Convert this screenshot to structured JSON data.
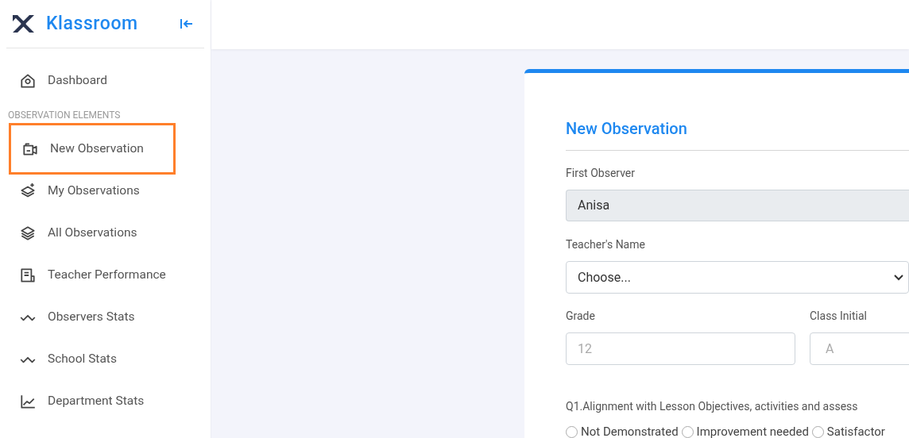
{
  "brand": {
    "name": "Klassroom"
  },
  "sidebar": {
    "items": [
      {
        "kind": "link",
        "label": "Dashboard",
        "highlighted": false
      },
      {
        "kind": "heading",
        "label": "OBSERVATION ELEMENTS"
      },
      {
        "kind": "link",
        "label": "New Observation",
        "highlighted": true
      },
      {
        "kind": "link",
        "label": "My Observations",
        "highlighted": false
      },
      {
        "kind": "link",
        "label": "All Observations",
        "highlighted": false
      },
      {
        "kind": "link",
        "label": "Teacher Performance",
        "highlighted": false
      },
      {
        "kind": "link",
        "label": "Observers Stats",
        "highlighted": false
      },
      {
        "kind": "link",
        "label": "School Stats",
        "highlighted": false
      },
      {
        "kind": "link",
        "label": "Department Stats",
        "highlighted": false
      }
    ]
  },
  "form": {
    "title": "New Observation",
    "first_observer": {
      "label": "First Observer",
      "value": "Anisa"
    },
    "teacher_name": {
      "label": "Teacher's Name",
      "value": "Choose..."
    },
    "grade": {
      "label": "Grade",
      "placeholder": "12"
    },
    "class_initial": {
      "label": "Class Initial",
      "placeholder": "A"
    },
    "question": {
      "text": "Q1.Alignment with Lesson Objectives, activities and assess",
      "options": [
        {
          "label": "Not Demonstrated",
          "selected": false
        },
        {
          "label": "Improvement needed",
          "selected": false
        },
        {
          "label": "Satisfactor",
          "selected": false
        }
      ]
    }
  }
}
